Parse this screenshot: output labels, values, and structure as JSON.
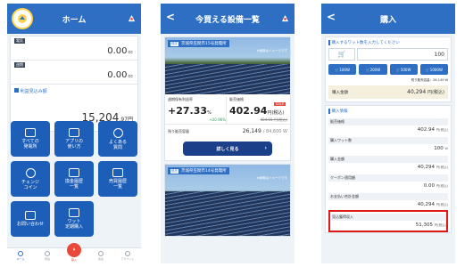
{
  "screen1": {
    "title": "ホーム",
    "balances": [
      {
        "label": "電気",
        "value": "0.00",
        "unit": "cc"
      },
      {
        "label": "週期",
        "value": "0.00",
        "unit": "cc"
      }
    ],
    "profit_label": "利益見込み額",
    "profit_value": "15,204",
    "profit_decimal": ".97",
    "profit_unit": "円",
    "menu": [
      {
        "l1": "すべての",
        "l2": "発電所"
      },
      {
        "l1": "アプリの",
        "l2": "使い方"
      },
      {
        "l1": "よくある",
        "l2": "質問"
      },
      {
        "l1": "チェンジ",
        "l2": "コイン"
      },
      {
        "l1": "換金履歴",
        "l2": "一覧"
      },
      {
        "l1": "売買履歴",
        "l2": "一覧"
      },
      {
        "l1": "お問い合わせ",
        "l2": ""
      },
      {
        "l1": "ワット",
        "l2": "定期購入"
      }
    ],
    "tabs": [
      "ホーム",
      "発電",
      "購入",
      "換金",
      "アカウント"
    ]
  },
  "screen2": {
    "title": "今買える設備一覧",
    "plant1": {
      "tag": "茨城県笠間市15号発電所",
      "tag_sub": "低圧",
      "note": "※画像はイメージです",
      "yield_label": "週期保有利益率",
      "yield_value": "+27.33",
      "yield_unit": "%",
      "yield_sub": "+20.96%",
      "price_label": "販売価格",
      "price_value": "402.94",
      "price_unit": "円(税込)",
      "price_sub": "424.15 円(税込)",
      "sale": "SALE",
      "remain_label": "残り販売容量",
      "remain_value": "26,149",
      "remain_total": "/ 84,600 W",
      "button": "詳しく見る"
    },
    "plant2": {
      "tag": "茨城県笠間市14号発電所",
      "tag_sub": "低圧",
      "note": "※画像はイメージです"
    }
  },
  "screen3": {
    "title": "購入",
    "qty_title": "購入するワット数を入力してください",
    "qty_value": "100",
    "qty_buttons": [
      "100",
      "200",
      "500",
      "1000"
    ],
    "qty_unit": "W",
    "capacity": "残り販売容量：26,149 W",
    "total_label": "購入金額",
    "total_value": "40,294",
    "total_unit": "円(税込)",
    "info_title": "購入情報",
    "info": [
      {
        "label": "販売価格",
        "value": "402.94",
        "unit": "円(税込)"
      },
      {
        "label": "購入ワット数",
        "value": "100",
        "unit": "W"
      },
      {
        "label": "購入金額",
        "value": "40,294",
        "unit": "円(税込)"
      },
      {
        "label": "クーポン適用額",
        "value": "0.00",
        "unit": "円(税込)"
      },
      {
        "label": "お支払い合計金額",
        "value": "40,294",
        "unit": "円(税込)"
      },
      {
        "label": "見込獲得収入",
        "value": "51,305",
        "unit": "円(税込)"
      }
    ]
  }
}
